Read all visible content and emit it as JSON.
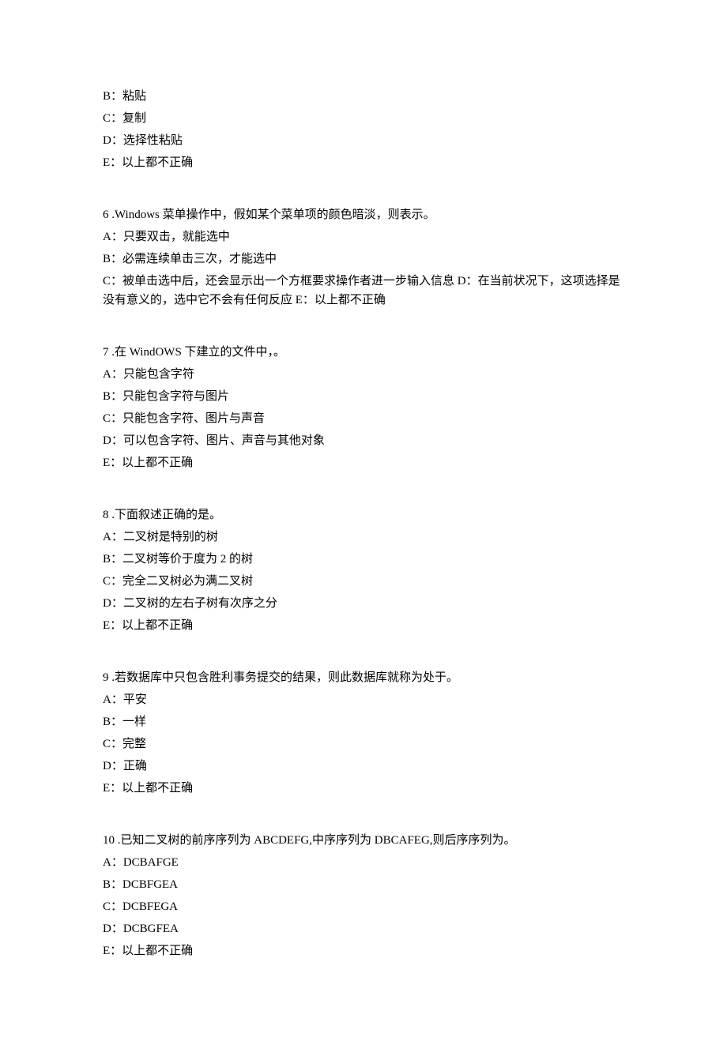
{
  "q5_partial": {
    "options": [
      "B：粘贴",
      "C：复制",
      "D：选择性粘贴",
      "E：以上都不正确"
    ]
  },
  "q6": {
    "stem": "6 .Windows 菜单操作中，假如某个菜单项的颜色暗淡，则表示。",
    "options": [
      "A：只要双击，就能选中",
      "B：必需连续单击三次，才能选中",
      "C：被单击选中后，还会显示出一个方框要求操作者进一步输入信息 D：在当前状况下，这项选择是没有意义的，选中它不会有任何反应 E：以上都不正确"
    ]
  },
  "q7": {
    "stem": "7 .在 WindOWS 下建立的文件中，。",
    "options": [
      "A：只能包含字符",
      "B：只能包含字符与图片",
      "C：只能包含字符、图片与声音",
      "D：可以包含字符、图片、声音与其他对象",
      "E：以上都不正确"
    ]
  },
  "q8": {
    "stem": "8 .下面叙述正确的是。",
    "options": [
      "A：二叉树是特别的树",
      "B：二叉树等价于度为 2 的树",
      "C：完全二叉树必为满二叉树",
      "D：二叉树的左右子树有次序之分",
      "E：以上都不正确"
    ]
  },
  "q9": {
    "stem": "9 .若数据库中只包含胜利事务提交的结果，则此数据库就称为处于。",
    "options": [
      "A：平安",
      "B：一样",
      "C：完整",
      "D：正确",
      "E：以上都不正确"
    ]
  },
  "q10": {
    "stem": "10 .已知二叉树的前序序列为 ABCDEFG,中序序列为 DBCAFEG,则后序序列为。",
    "options": [
      "A：DCBAFGE",
      "B：DCBFGEA",
      "C：DCBFEGA",
      "D：DCBGFEA",
      "E：以上都不正确"
    ]
  }
}
